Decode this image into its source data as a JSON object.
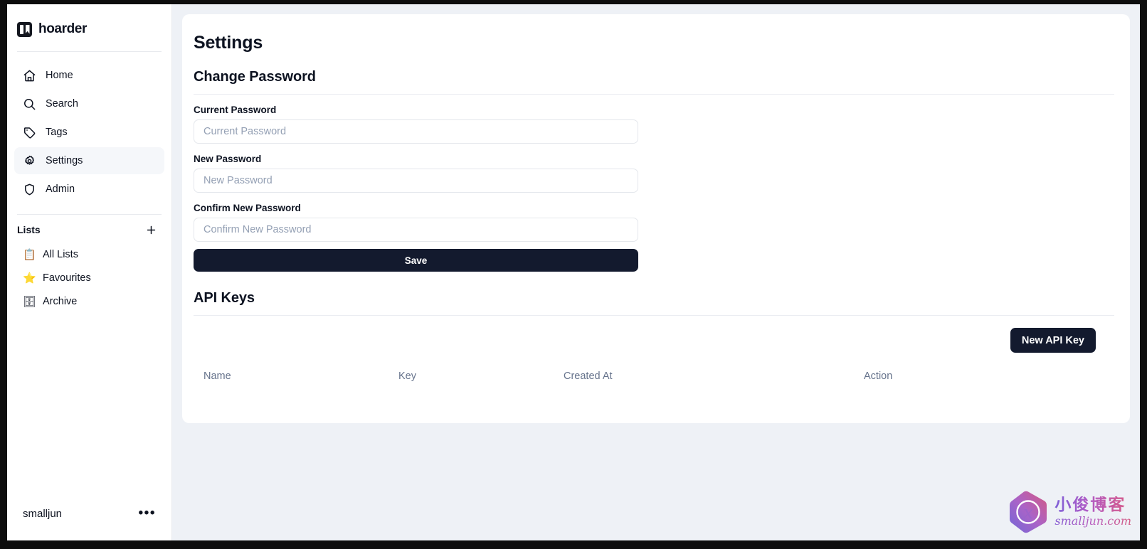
{
  "app": {
    "brand": "hoarder",
    "brand_icon": "hoarder-logo-icon"
  },
  "sidebar": {
    "nav_items": [
      {
        "label": "Home",
        "icon": "home-icon",
        "active": false
      },
      {
        "label": "Search",
        "icon": "search-icon",
        "active": false
      },
      {
        "label": "Tags",
        "icon": "tag-icon",
        "active": false
      },
      {
        "label": "Settings",
        "icon": "gear-icon",
        "active": true
      },
      {
        "label": "Admin",
        "icon": "shield-icon",
        "active": false
      }
    ],
    "lists": {
      "title": "Lists",
      "add_icon": "plus-icon",
      "items": [
        {
          "label": "All Lists",
          "emoji": "📋",
          "icon": "clipboard-icon"
        },
        {
          "label": "Favourites",
          "emoji": "⭐",
          "icon": "star-icon"
        },
        {
          "label": "Archive",
          "emoji": "🗄",
          "icon": "archive-icon"
        }
      ]
    },
    "user": {
      "name": "smalljun",
      "menu_glyph": "•••"
    }
  },
  "main": {
    "page_title": "Settings",
    "change_password": {
      "title": "Change Password",
      "fields": [
        {
          "label": "Current Password",
          "value": "",
          "placeholder": "Current Password"
        },
        {
          "label": "New Password",
          "value": "",
          "placeholder": "New Password"
        },
        {
          "label": "Confirm New Password",
          "value": "",
          "placeholder": "Confirm New Password"
        }
      ],
      "save_label": "Save"
    },
    "api_keys": {
      "title": "API Keys",
      "new_key_label": "New API Key",
      "columns": [
        "Name",
        "Key",
        "Created At",
        "Action"
      ],
      "rows": []
    }
  },
  "watermark": {
    "cn_text": "小俊博客",
    "url_text": "smalljun.com",
    "logo_icon": "hexagon-x-logo-icon"
  },
  "colors": {
    "accent_dark": "#131a2e",
    "page_bg": "#eef1f6",
    "card_bg": "#ffffff",
    "muted_text": "#66738c",
    "placeholder": "#94a0b4",
    "border": "#e4e7ec"
  }
}
